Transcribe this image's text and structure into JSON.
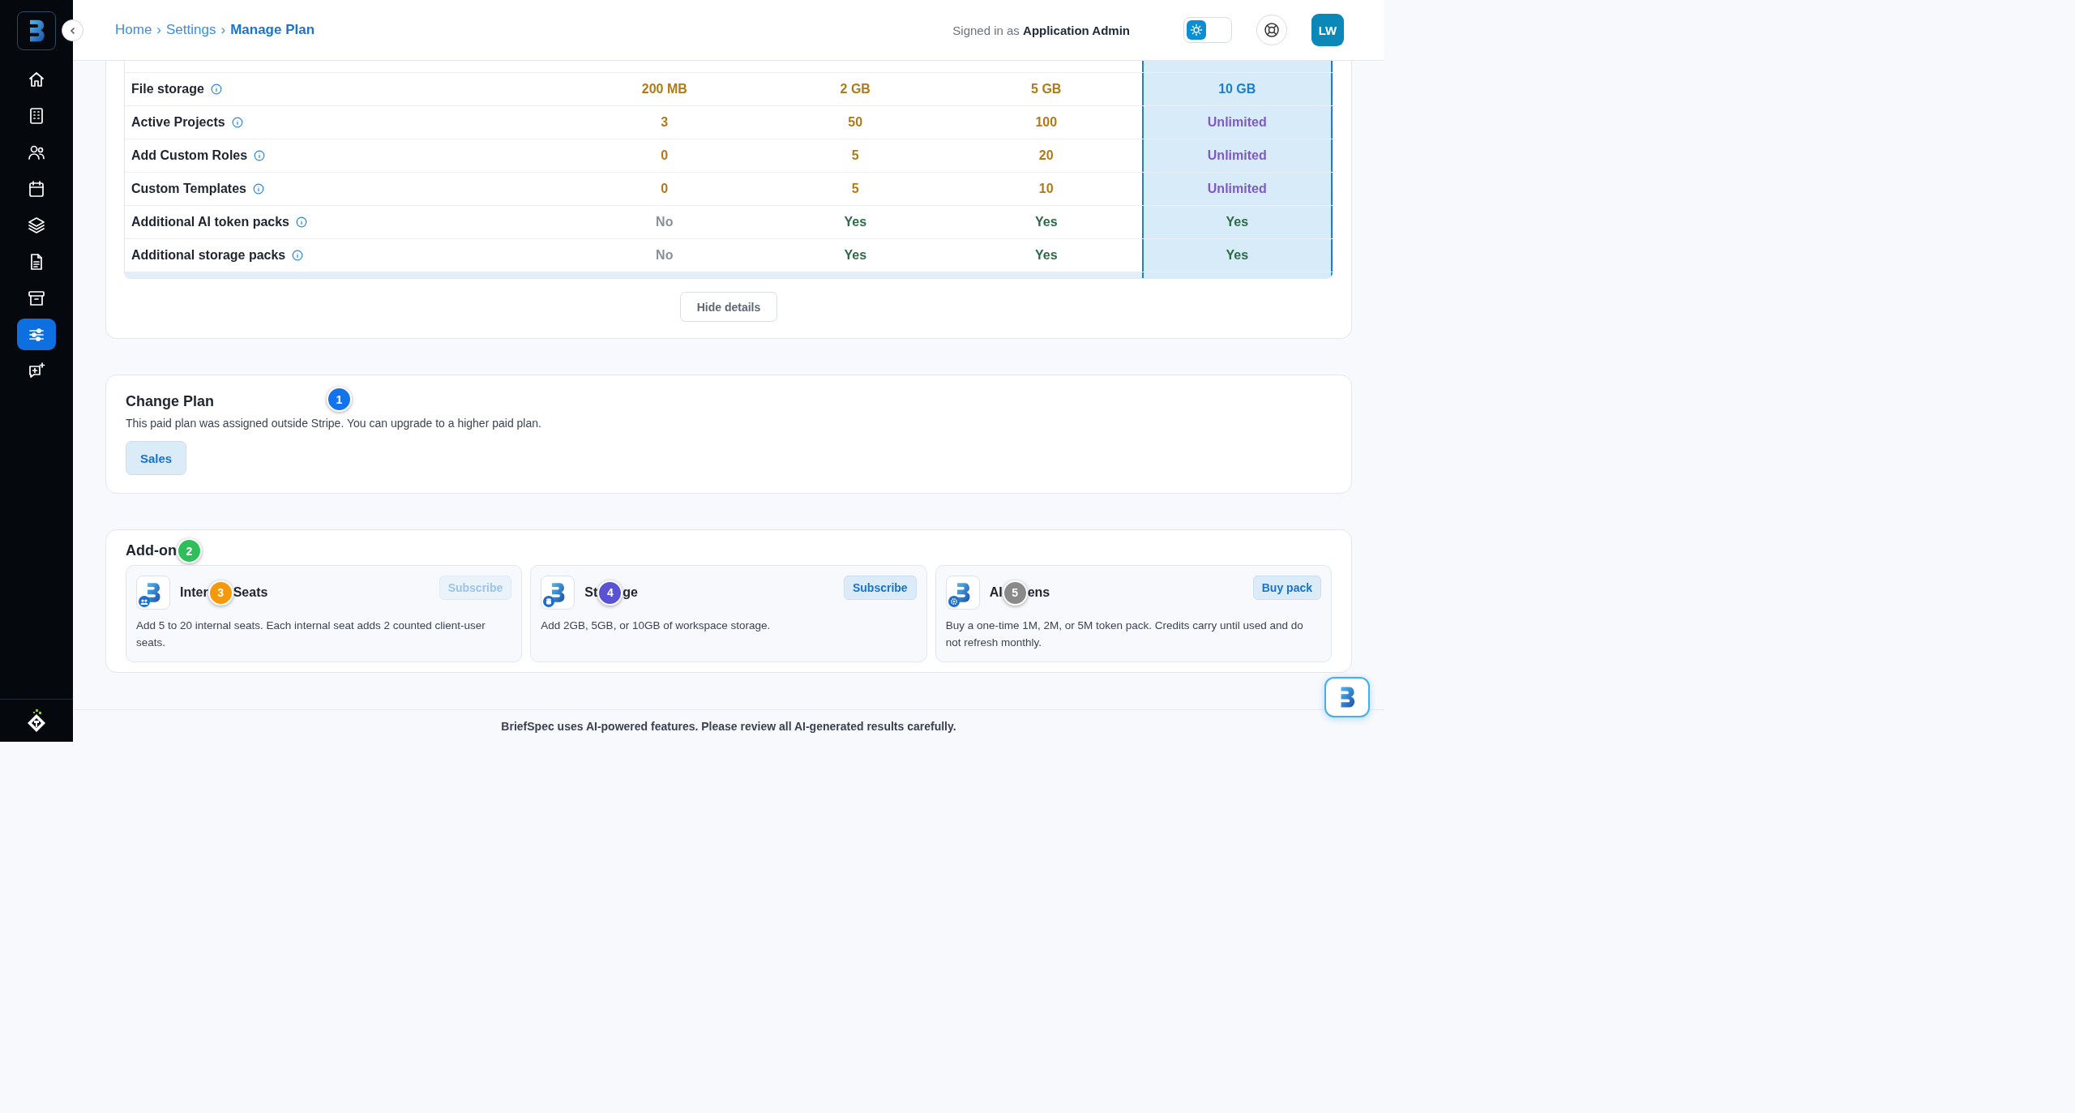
{
  "sidebar": {
    "items": [
      {
        "kind": "home",
        "selected": false
      },
      {
        "kind": "building",
        "selected": false
      },
      {
        "kind": "users",
        "selected": false
      },
      {
        "kind": "calendar",
        "selected": false
      },
      {
        "kind": "layers",
        "selected": false
      },
      {
        "kind": "document",
        "selected": false
      },
      {
        "kind": "archive",
        "selected": false
      },
      {
        "kind": "sliders",
        "selected": true
      },
      {
        "kind": "chat",
        "selected": false
      }
    ]
  },
  "header": {
    "breadcrumb": [
      {
        "text": "Home",
        "current": false
      },
      {
        "text": "Settings",
        "current": false
      },
      {
        "text": "Manage Plan",
        "current": true
      }
    ],
    "separator": "›",
    "signed_in": "Signed in as **Application Admin**",
    "theme_toggle": {
      "on": false
    },
    "avatar": "LW"
  },
  "plan_table": {
    "columns": [
      {
        "selected": false
      },
      {
        "selected": false
      },
      {
        "selected": false
      },
      {
        "selected": true
      }
    ],
    "rows": [
      {
        "label": "File storage",
        "values": [
          {
            "text": "200 MB",
            "kind": "amount"
          },
          {
            "text": "2 GB",
            "kind": "amount"
          },
          {
            "text": "5 GB",
            "kind": "amount"
          },
          {
            "text": "10 GB",
            "kind": "amount"
          }
        ]
      },
      {
        "label": "Active Projects",
        "values": [
          {
            "text": "3",
            "kind": "amount"
          },
          {
            "text": "50",
            "kind": "amount"
          },
          {
            "text": "100",
            "kind": "amount"
          },
          {
            "text": "Unlimited",
            "kind": "unlimited"
          }
        ]
      },
      {
        "label": "Add Custom Roles",
        "values": [
          {
            "text": "0",
            "kind": "amount"
          },
          {
            "text": "5",
            "kind": "amount"
          },
          {
            "text": "20",
            "kind": "amount"
          },
          {
            "text": "Unlimited",
            "kind": "unlimited"
          }
        ]
      },
      {
        "label": "Custom Templates",
        "values": [
          {
            "text": "0",
            "kind": "amount"
          },
          {
            "text": "5",
            "kind": "amount"
          },
          {
            "text": "10",
            "kind": "amount"
          },
          {
            "text": "Unlimited",
            "kind": "unlimited"
          }
        ]
      },
      {
        "label": "Additional AI token packs",
        "values": [
          {
            "text": "No",
            "kind": "no"
          },
          {
            "text": "Yes",
            "kind": "yes"
          },
          {
            "text": "Yes",
            "kind": "yes"
          },
          {
            "text": "Yes",
            "kind": "yes"
          }
        ]
      },
      {
        "label": "Additional storage packs",
        "values": [
          {
            "text": "No",
            "kind": "no"
          },
          {
            "text": "Yes",
            "kind": "yes"
          },
          {
            "text": "Yes",
            "kind": "yes"
          },
          {
            "text": "Yes",
            "kind": "yes"
          }
        ]
      }
    ],
    "toggle_button": "Hide details"
  },
  "change_plan": {
    "title": "Change Plan",
    "badge": {
      "text": "1",
      "color": "#1273ea"
    },
    "description": "This paid plan was assigned outside Stripe. You can upgrade to a higher paid plan.",
    "button": "Sales"
  },
  "addons": {
    "title": "Add-on",
    "badge": {
      "text": "2",
      "color": "#2fbf5a"
    },
    "items": [
      {
        "kind": "seats",
        "title_before": "Inter",
        "title_after": "Seats",
        "badge": {
          "text": "3",
          "color": "#f5990c"
        },
        "button": "Subscribe",
        "disabled": true,
        "description": "Add 5 to 20 internal seats. Each internal seat adds 2 counted client-user seats."
      },
      {
        "kind": "storage",
        "title_before": "St",
        "title_after": "ge",
        "badge": {
          "text": "4",
          "color": "#5a52d5"
        },
        "button": "Subscribe",
        "disabled": false,
        "description": "Add 2GB, 5GB, or 10GB of workspace storage."
      },
      {
        "kind": "tokens",
        "title_before": "AI",
        "title_after": "ens",
        "badge": {
          "text": "5",
          "color": "#8a8a8a"
        },
        "button": "Buy pack",
        "disabled": false,
        "description": "Buy a one-time 1M, 2M, or 5M token pack. Credits carry until used and do not refresh monthly."
      }
    ]
  },
  "footer": "BriefSpec uses AI-powered features. Please review all AI-generated results carefully."
}
